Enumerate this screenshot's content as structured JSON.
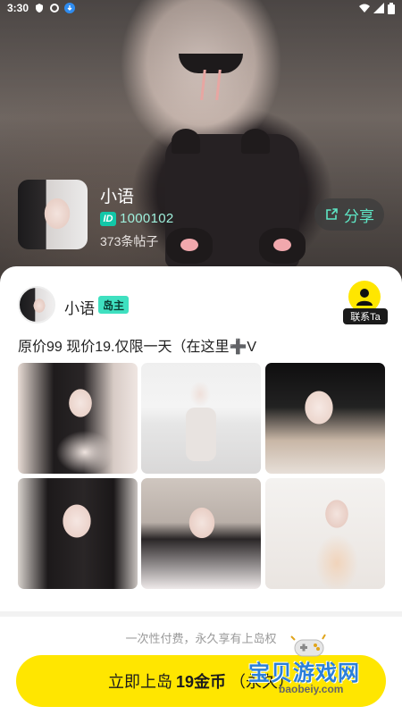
{
  "status_bar": {
    "time": "3:30"
  },
  "profile": {
    "name": "小语",
    "id_label": "ID",
    "id_number": "1000102",
    "posts": "373条帖子",
    "share_label": "分享"
  },
  "post": {
    "author": "小语",
    "owner_badge": "岛主",
    "contact_label": "联系Ta",
    "text": "原价99 现价19.仅限一天（在这里➕V"
  },
  "footer": {
    "notice": "一次性付费，永久享有上岛权",
    "cta_prefix": "立即上岛",
    "cta_amount": "19金币",
    "cta_suffix": "（永久）"
  },
  "watermark": {
    "text": "宝贝游戏网",
    "url": "baobeiy.com"
  },
  "colors": {
    "accent_yellow": "#ffe600",
    "accent_teal": "#3fe0c0",
    "share_text": "#5ee7c6"
  }
}
